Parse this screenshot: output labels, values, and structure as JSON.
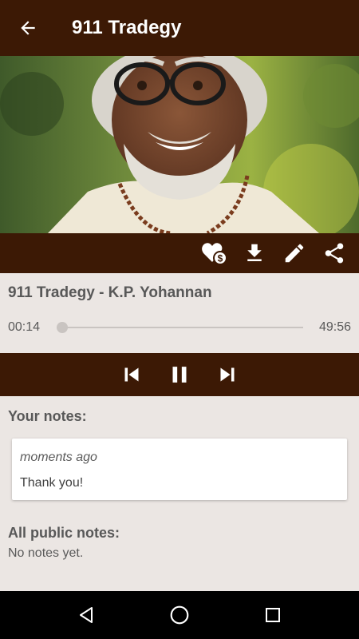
{
  "app_bar": {
    "title": "911 Tradegy",
    "back_icon": "arrow-back-icon"
  },
  "hero": {
    "image_subject": "speaker-portrait"
  },
  "actions": [
    {
      "icon": "heart-donate-icon"
    },
    {
      "icon": "download-icon"
    },
    {
      "icon": "pencil-icon"
    },
    {
      "icon": "share-icon"
    }
  ],
  "player": {
    "track_title": "911 Tradegy - K.P. Yohannan",
    "elapsed": "00:14",
    "duration": "49:56",
    "progress": 0.005
  },
  "controls": {
    "prev_icon": "skip-previous-icon",
    "pause_icon": "pause-icon",
    "next_icon": "skip-next-icon"
  },
  "notes": {
    "your_heading": "Your notes:",
    "items": [
      {
        "time": "moments ago",
        "text": "Thank you!"
      }
    ],
    "public_heading": "All public notes:",
    "public_empty": "No notes yet."
  },
  "colors": {
    "primary": "#3c1905",
    "background": "#ebe6e3",
    "text": "#585858"
  }
}
